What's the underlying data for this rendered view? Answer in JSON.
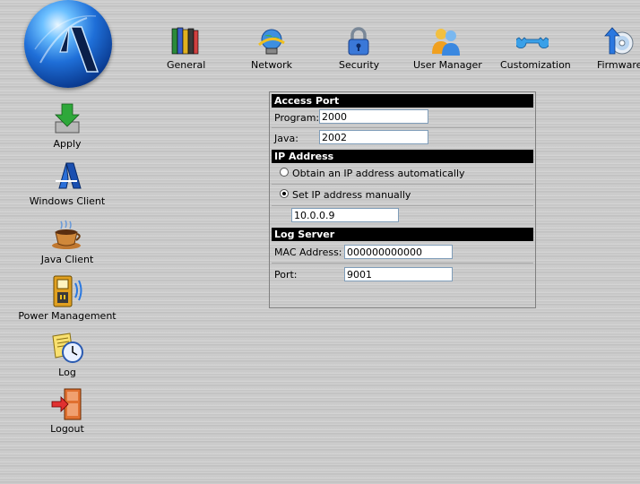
{
  "top_nav": [
    {
      "label": "General",
      "icon": "books-icon"
    },
    {
      "label": "Network",
      "icon": "network-globe-icon"
    },
    {
      "label": "Security",
      "icon": "padlock-icon"
    },
    {
      "label": "User Manager",
      "icon": "users-icon"
    },
    {
      "label": "Customization",
      "icon": "wrench-icon"
    },
    {
      "label": "Firmware",
      "icon": "firmware-disc-icon"
    }
  ],
  "sidebar": [
    {
      "label": "Apply",
      "icon": "apply-arrow-icon"
    },
    {
      "label": "Windows Client",
      "icon": "windows-client-icon"
    },
    {
      "label": "Java Client",
      "icon": "coffee-cup-icon"
    },
    {
      "label": "Power Management",
      "icon": "power-management-icon"
    },
    {
      "label": "Log",
      "icon": "log-clock-icon"
    },
    {
      "label": "Logout",
      "icon": "logout-door-icon"
    }
  ],
  "access_port": {
    "title": "Access Port",
    "program_label": "Program:",
    "program_value": "2000",
    "java_label": "Java:",
    "java_value": "2002"
  },
  "ip_address": {
    "title": "IP Address",
    "option_auto": "Obtain an IP address automatically",
    "option_manual": "Set IP address manually",
    "selected": "manual",
    "ip_value": "10.0.0.9"
  },
  "log_server": {
    "title": "Log Server",
    "mac_label": "MAC Address:",
    "mac_value": "000000000000",
    "port_label": "Port:",
    "port_value": "9001"
  },
  "colors": {
    "header_bg": "#000000",
    "header_text": "#ffffff",
    "background": "#c9c9c9"
  }
}
